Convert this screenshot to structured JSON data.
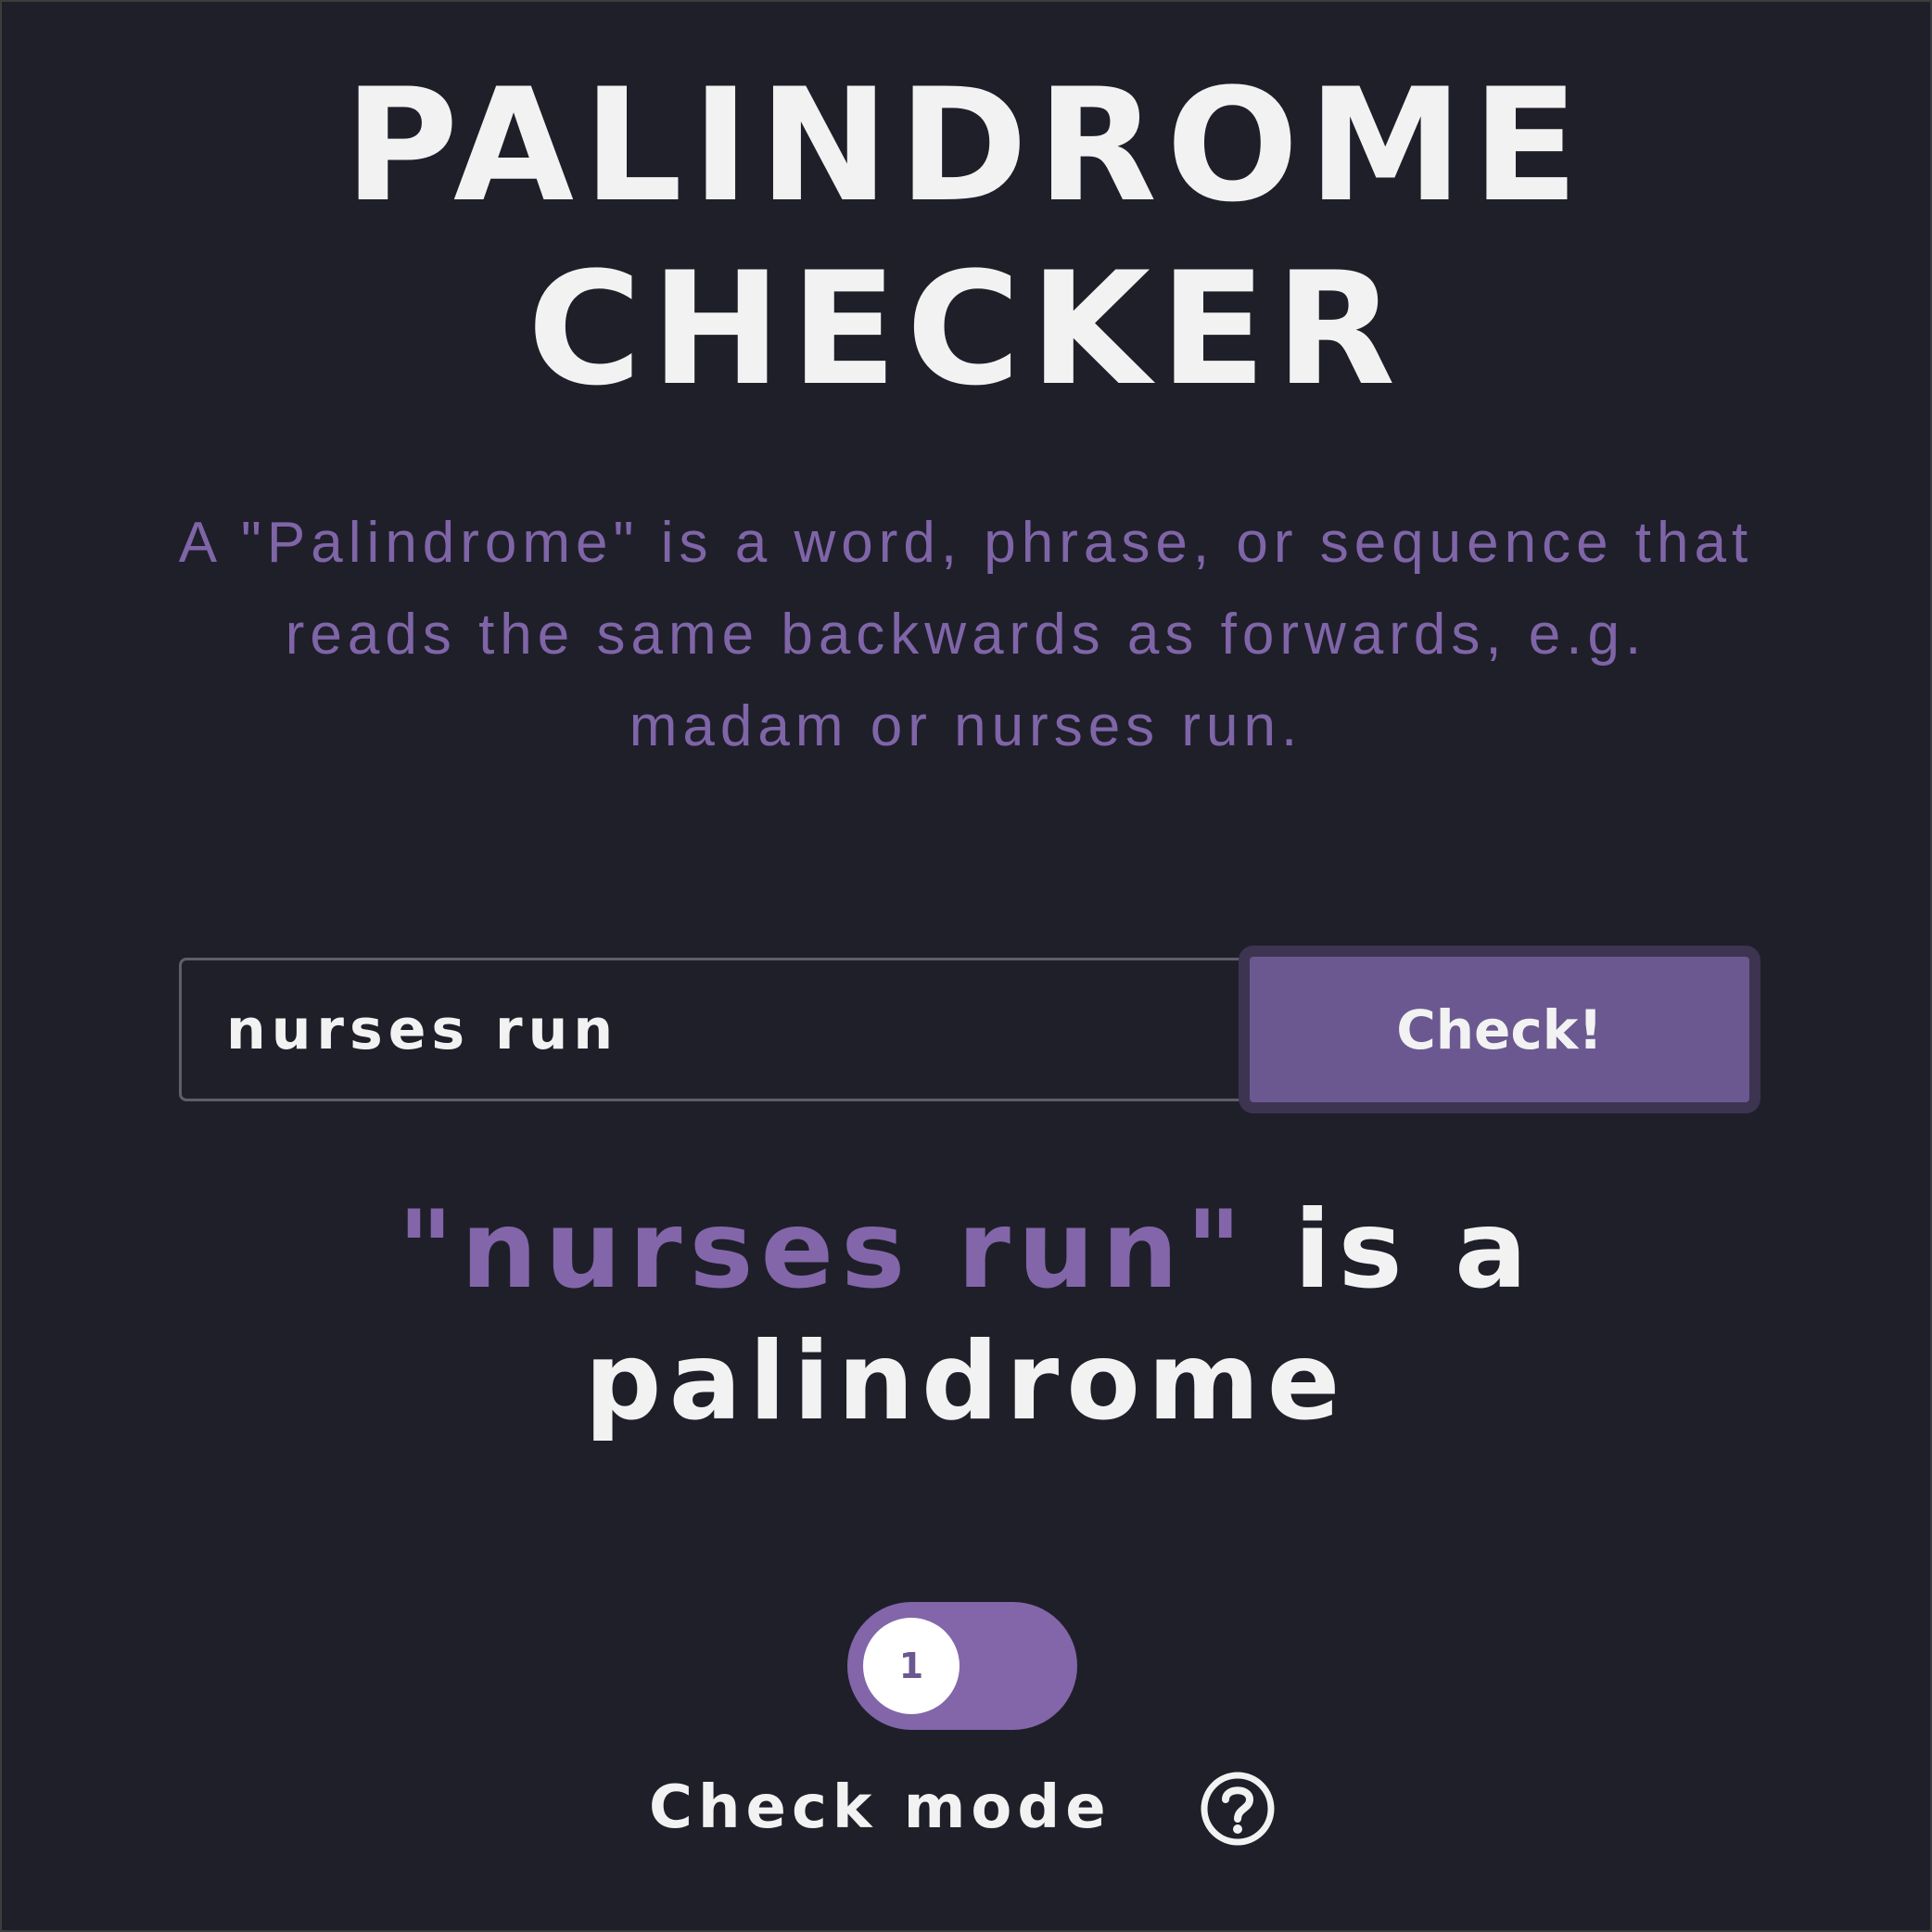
{
  "header": {
    "title_line1": "PALINDROME",
    "title_line2": "CHECKER"
  },
  "description": "A \"Palindrome\" is a word, phrase, or sequence that reads the same backwards as forwards, e.g. madam or nurses run.",
  "form": {
    "input_value": "nurses run",
    "check_label": "Check!"
  },
  "result": {
    "term": "\"nurses run\"",
    "message": " is a palindrome"
  },
  "mode": {
    "toggle_value": "1",
    "label": "Check mode",
    "help_icon": "question-circle-icon"
  },
  "colors": {
    "background": "#1f1f29",
    "accent": "#8266a9",
    "button": "#6b5890",
    "text": "#f2f2f2"
  }
}
